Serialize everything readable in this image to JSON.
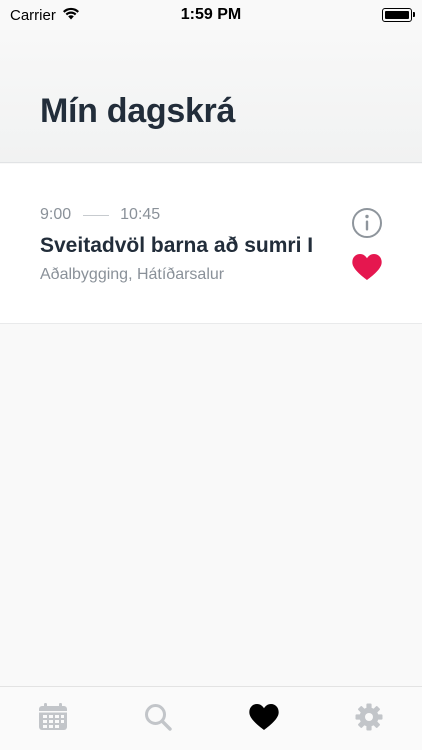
{
  "status_bar": {
    "carrier": "Carrier",
    "time": "1:59 PM"
  },
  "header": {
    "title": "Mín dagskrá"
  },
  "event": {
    "start_time": "9:00",
    "end_time": "10:45",
    "title": "Sveitadvöl barna að sumri I",
    "location": "Aðalbygging, Hátíðarsalur",
    "favorited": true
  },
  "tab_bar": {
    "items": [
      {
        "icon": "calendar-icon",
        "selected": false
      },
      {
        "icon": "search-icon",
        "selected": false
      },
      {
        "icon": "heart-icon",
        "selected": true
      },
      {
        "icon": "gear-icon",
        "selected": false
      }
    ]
  },
  "colors": {
    "accent_heart": "#e5174f",
    "title_text": "#222d3a",
    "secondary_text": "#8a9199",
    "tab_inactive": "#c2c5c9",
    "tab_active": "#000000"
  }
}
